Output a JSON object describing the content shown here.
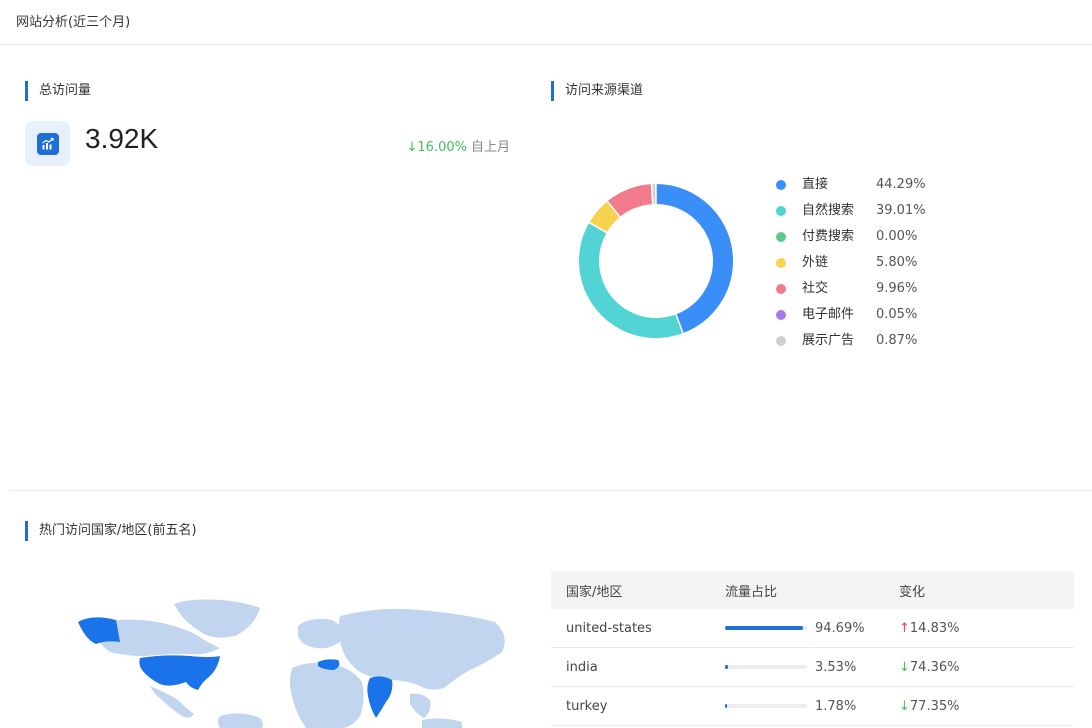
{
  "header": {
    "title": "网站分析(近三个月)"
  },
  "total_visits": {
    "title": "总访问量",
    "icon": "trend-chart-icon",
    "value": "3.92K",
    "change_arrow": "↓",
    "change_value": "16.00%",
    "change_label": "自上月"
  },
  "traffic_sources": {
    "title": "访问来源渠道",
    "chart_data": {
      "type": "pie",
      "categories": [
        "直接",
        "自然搜索",
        "付费搜索",
        "外链",
        "社交",
        "电子邮件",
        "展示广告"
      ],
      "values": [
        44.29,
        39.01,
        0.0,
        5.8,
        9.96,
        0.05,
        0.87
      ],
      "value_labels": [
        "44.29%",
        "39.01%",
        "0.00%",
        "5.80%",
        "9.96%",
        "0.05%",
        "0.87%"
      ],
      "colors": [
        "#3a8ef8",
        "#52d4d4",
        "#5cc98b",
        "#f7d34d",
        "#f27b8b",
        "#a47ce0",
        "#cfcfcf"
      ],
      "donut": true,
      "legend": "right"
    }
  },
  "top_countries": {
    "title": "热门访问国家/地区(前五名)",
    "headers": [
      "国家/地区",
      "流量占比",
      "变化"
    ],
    "rows": [
      {
        "country": "united-states",
        "share": 94.69,
        "share_label": "94.69%",
        "arrow": "↑",
        "direction": "up",
        "change": "14.83%"
      },
      {
        "country": "india",
        "share": 3.53,
        "share_label": "3.53%",
        "arrow": "↓",
        "direction": "down",
        "change": "74.36%"
      },
      {
        "country": "turkey",
        "share": 1.78,
        "share_label": "1.78%",
        "arrow": "↓",
        "direction": "down",
        "change": "77.35%"
      }
    ]
  },
  "colors": {
    "accent": "#1f6fd6",
    "map_land": "#c2d5ee",
    "map_highlight": "#1a73e8",
    "up": "#e64545",
    "down": "#3ec25a"
  }
}
